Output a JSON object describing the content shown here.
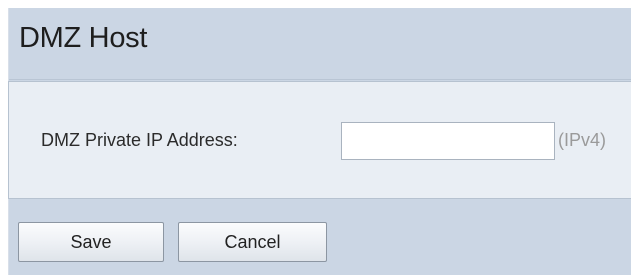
{
  "page": {
    "title": "DMZ Host"
  },
  "form": {
    "ip_label": "DMZ Private IP Address:",
    "ip_value": "",
    "ip_hint": "(IPv4)"
  },
  "actions": {
    "save_label": "Save",
    "cancel_label": "Cancel"
  },
  "colors": {
    "background": "#cbd6e4",
    "panel": "#e9eef4",
    "hint_text": "#9a9a9a"
  }
}
